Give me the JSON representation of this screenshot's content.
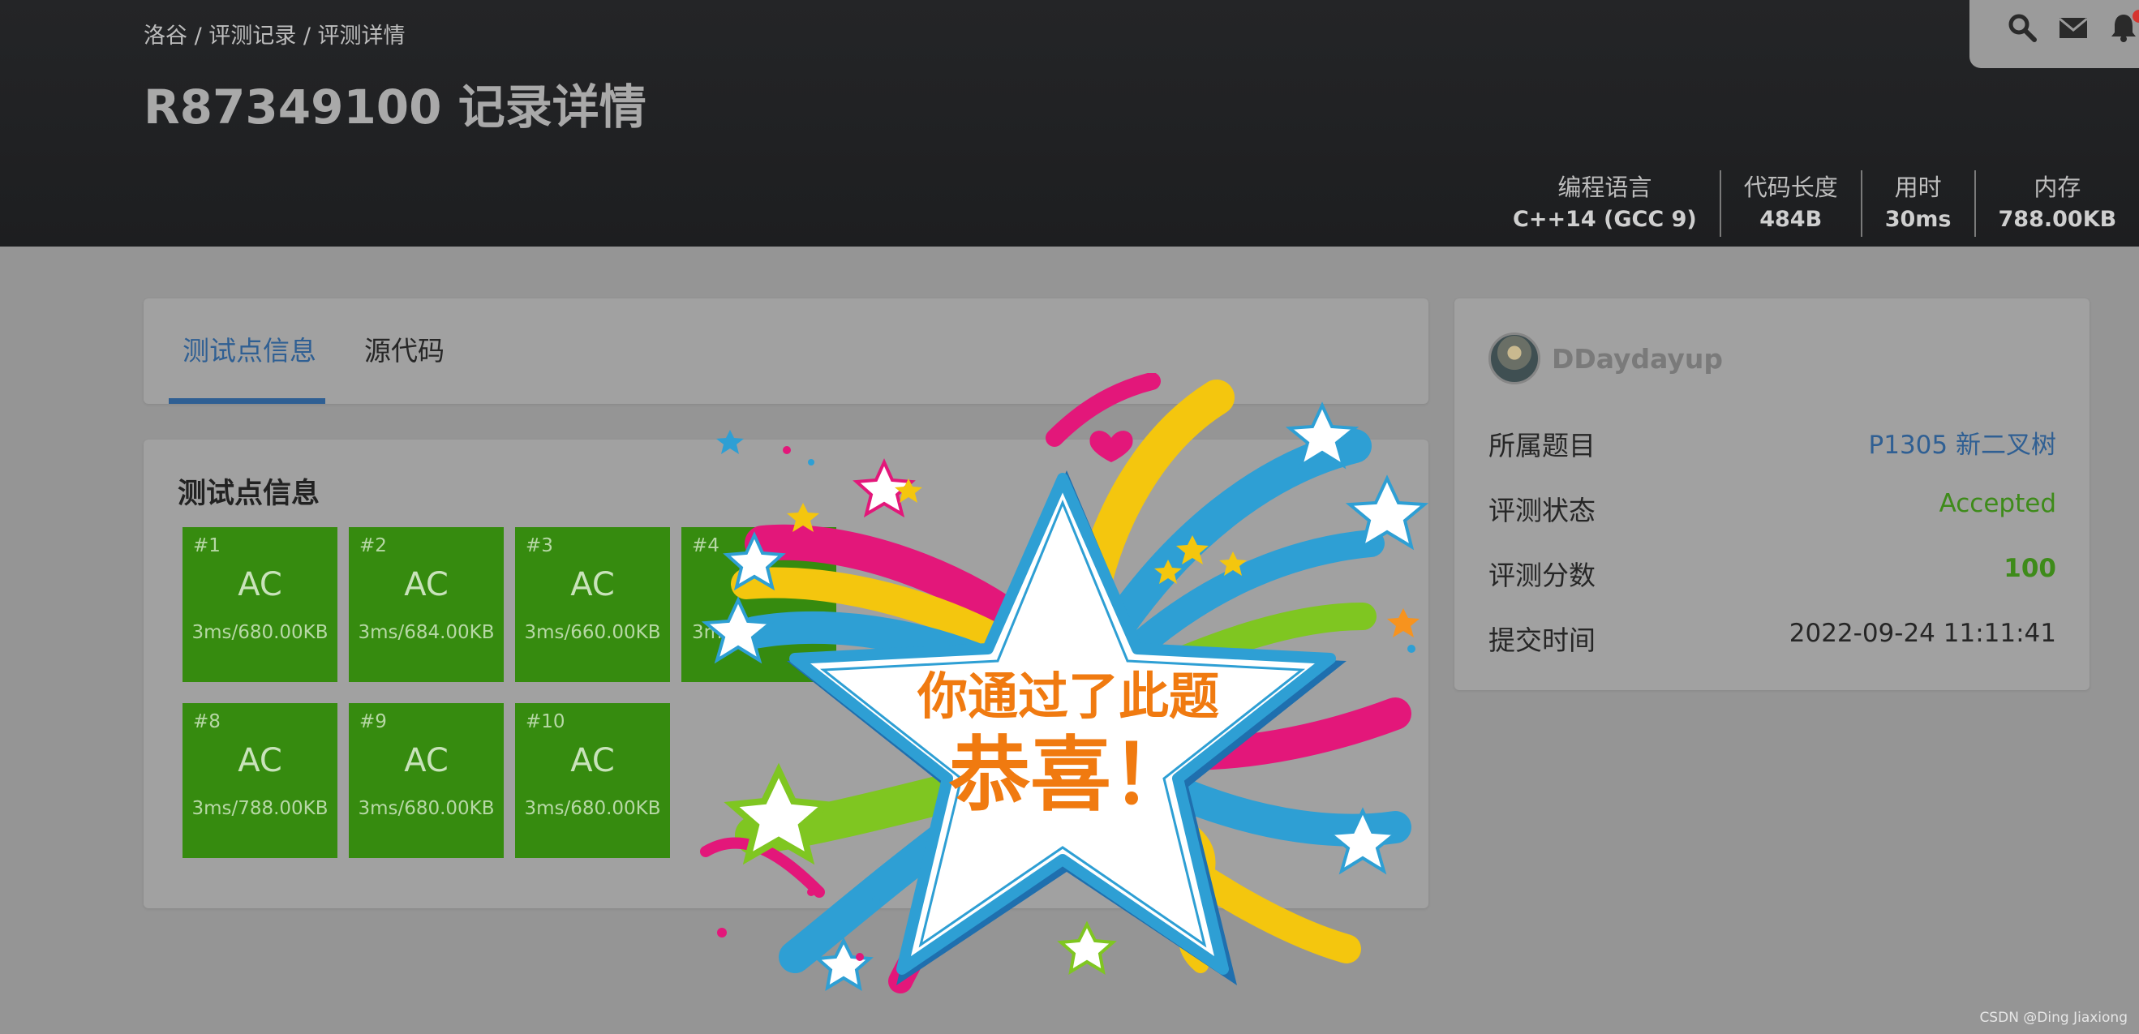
{
  "header": {
    "breadcrumb": "洛谷 / 评测记录 / 评测详情",
    "title": "R87349100 记录详情",
    "stats": [
      {
        "label": "编程语言",
        "value": "C++14 (GCC 9)"
      },
      {
        "label": "代码长度",
        "value": "484B"
      },
      {
        "label": "用时",
        "value": "30ms"
      },
      {
        "label": "内存",
        "value": "788.00KB"
      }
    ],
    "toolbar_icons": [
      "search-icon",
      "mail-icon",
      "bell-icon"
    ]
  },
  "tabs": {
    "testcases": "测试点信息",
    "source": "源代码",
    "active": "testcases"
  },
  "cases": {
    "title": "测试点信息",
    "items": [
      {
        "id": "#1",
        "status": "AC",
        "meta": "3ms/680.00KB"
      },
      {
        "id": "#2",
        "status": "AC",
        "meta": "3ms/684.00KB"
      },
      {
        "id": "#3",
        "status": "AC",
        "meta": "3ms/660.00KB"
      },
      {
        "id": "#4",
        "status": "",
        "meta": "3ms/"
      },
      {
        "id": "#8",
        "status": "AC",
        "meta": "3ms/788.00KB"
      },
      {
        "id": "#9",
        "status": "AC",
        "meta": "3ms/680.00KB"
      },
      {
        "id": "#10",
        "status": "AC",
        "meta": "3ms/680.00KB"
      }
    ]
  },
  "info": {
    "username": "DDaydayup",
    "problem_label": "所属题目",
    "problem_value": "P1305 新二叉树",
    "status_label": "评测状态",
    "status_value": "Accepted",
    "score_label": "评测分数",
    "score_value": "100",
    "time_label": "提交时间",
    "time_value": "2022-09-24 11:11:41"
  },
  "celebration": {
    "line1": "你通过了此题",
    "line2": "恭喜！"
  },
  "watermark": "CSDN @Ding Jiaxiong",
  "colors": {
    "ac_green": "#368b0f",
    "link_blue": "#2f5f93",
    "accepted_green": "#3e8b1a",
    "header_dark": "#1f2022",
    "celebration_orange": "#f07a10"
  }
}
